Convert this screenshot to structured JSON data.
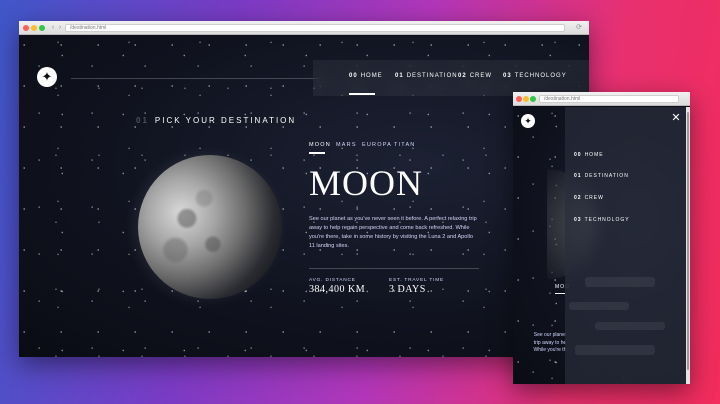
{
  "main": {
    "url": "/destination.html",
    "logo_glyph": "✦",
    "nav": [
      {
        "num": "00",
        "label": "HOME"
      },
      {
        "num": "01",
        "label": "DESTINATION"
      },
      {
        "num": "02",
        "label": "CREW"
      },
      {
        "num": "03",
        "label": "TECHNOLOGY"
      }
    ],
    "eyebrow": {
      "num": "01",
      "text": "PICK YOUR DESTINATION"
    },
    "tabs": [
      "MOON",
      "MARS",
      "EUROPA",
      "TITAN"
    ],
    "title": "MOON",
    "description": "See our planet as you've never seen it before. A perfect relaxing trip away to help regain perspective and come back refreshed. While you're there, take in some history by visiting the Luna 2 and Apollo 11 landing sites.",
    "stats": [
      {
        "label": "AVG. DISTANCE",
        "value": "384,400 KM"
      },
      {
        "label": "EST. TRAVEL TIME",
        "value": "3 DAYS"
      }
    ]
  },
  "mobile": {
    "url": "/destination.html",
    "logo_glyph": "✦",
    "close_glyph": "✕",
    "menu": [
      {
        "num": "00",
        "label": "HOME"
      },
      {
        "num": "01",
        "label": "DESTINATION"
      },
      {
        "num": "02",
        "label": "CREW"
      },
      {
        "num": "03",
        "label": "TECHNOLOGY"
      }
    ],
    "tab_visible": "MOO",
    "description_lines": [
      "See our planet",
      "trip away to he",
      "While you're th"
    ]
  },
  "colors": {
    "space": "#0b0d17",
    "light_text": "#d0d6f9",
    "white": "#ffffff"
  },
  "icons": [
    "star-logo-icon",
    "close-icon",
    "reload-icon",
    "back-icon",
    "forward-icon"
  ]
}
